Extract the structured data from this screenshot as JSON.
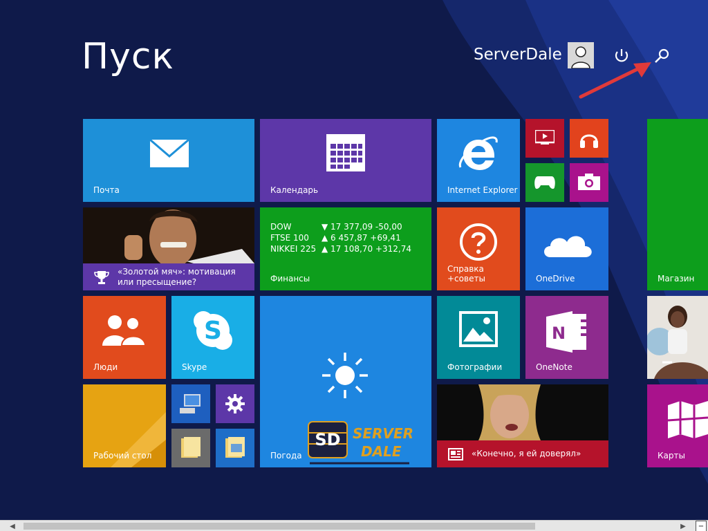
{
  "header": {
    "title": "Пуск",
    "username": "ServerDale"
  },
  "tiles": {
    "mail": {
      "label": "Почта",
      "color": "#1e90d8"
    },
    "calendar": {
      "label": "Календарь",
      "color": "#5d37a8"
    },
    "ie": {
      "label": "Internet Explorer",
      "color": "#1e86e0"
    },
    "video": {
      "color": "#b5132b"
    },
    "music": {
      "color": "#e2431d"
    },
    "games": {
      "color": "#15962c"
    },
    "camera": {
      "color": "#a9128c"
    },
    "news": {
      "label": "«Золотой мяч»: мотивация или пресыщение?",
      "color": "#5d37a8"
    },
    "finance": {
      "label": "Финансы",
      "color": "#0d9e1c",
      "rows": [
        {
          "name": "DOW",
          "value": "▼ 17 377,09 -50,00"
        },
        {
          "name": "FTSE 100",
          "value": "▲ 6 457,87 +69,41"
        },
        {
          "name": "NIKKEI 225",
          "value": "▲ 17 108,70 +312,74"
        }
      ]
    },
    "help": {
      "label": "Справка +советы",
      "color": "#e14b1d"
    },
    "onedrive": {
      "label": "OneDrive",
      "color": "#1c6ed8"
    },
    "store": {
      "label": "Магазин",
      "color": "#0d9e1c"
    },
    "people": {
      "label": "Люди",
      "color": "#e14b1d"
    },
    "skype": {
      "label": "Skype",
      "color": "#19aee6"
    },
    "weather": {
      "label": "Погода",
      "color": "#1e86e0"
    },
    "photos": {
      "label": "Фотографии",
      "color": "#028a97"
    },
    "onenote": {
      "label": "OneNote",
      "color": "#8e2b8e"
    },
    "health": {
      "color": "#e0e0e0"
    },
    "desktop": {
      "label": "Рабочий стол",
      "color": "#e8a90a"
    },
    "computer": {
      "color": "#1e5fbf"
    },
    "settings": {
      "color": "#5d37a8"
    },
    "explorer": {
      "color": "#6b6b6b"
    },
    "pictures": {
      "color": "#1e6ec8"
    },
    "video_story": {
      "label": "«Конечно, я ей доверял»",
      "color": "#b5132b"
    },
    "maps": {
      "label": "Карты",
      "color": "#a9128c"
    }
  },
  "watermark": {
    "text1": "SD",
    "text2": "SERVER",
    "text3": "DALE"
  },
  "icons": {
    "power": "power-icon",
    "search": "search-icon",
    "arrow": "red-arrow"
  }
}
